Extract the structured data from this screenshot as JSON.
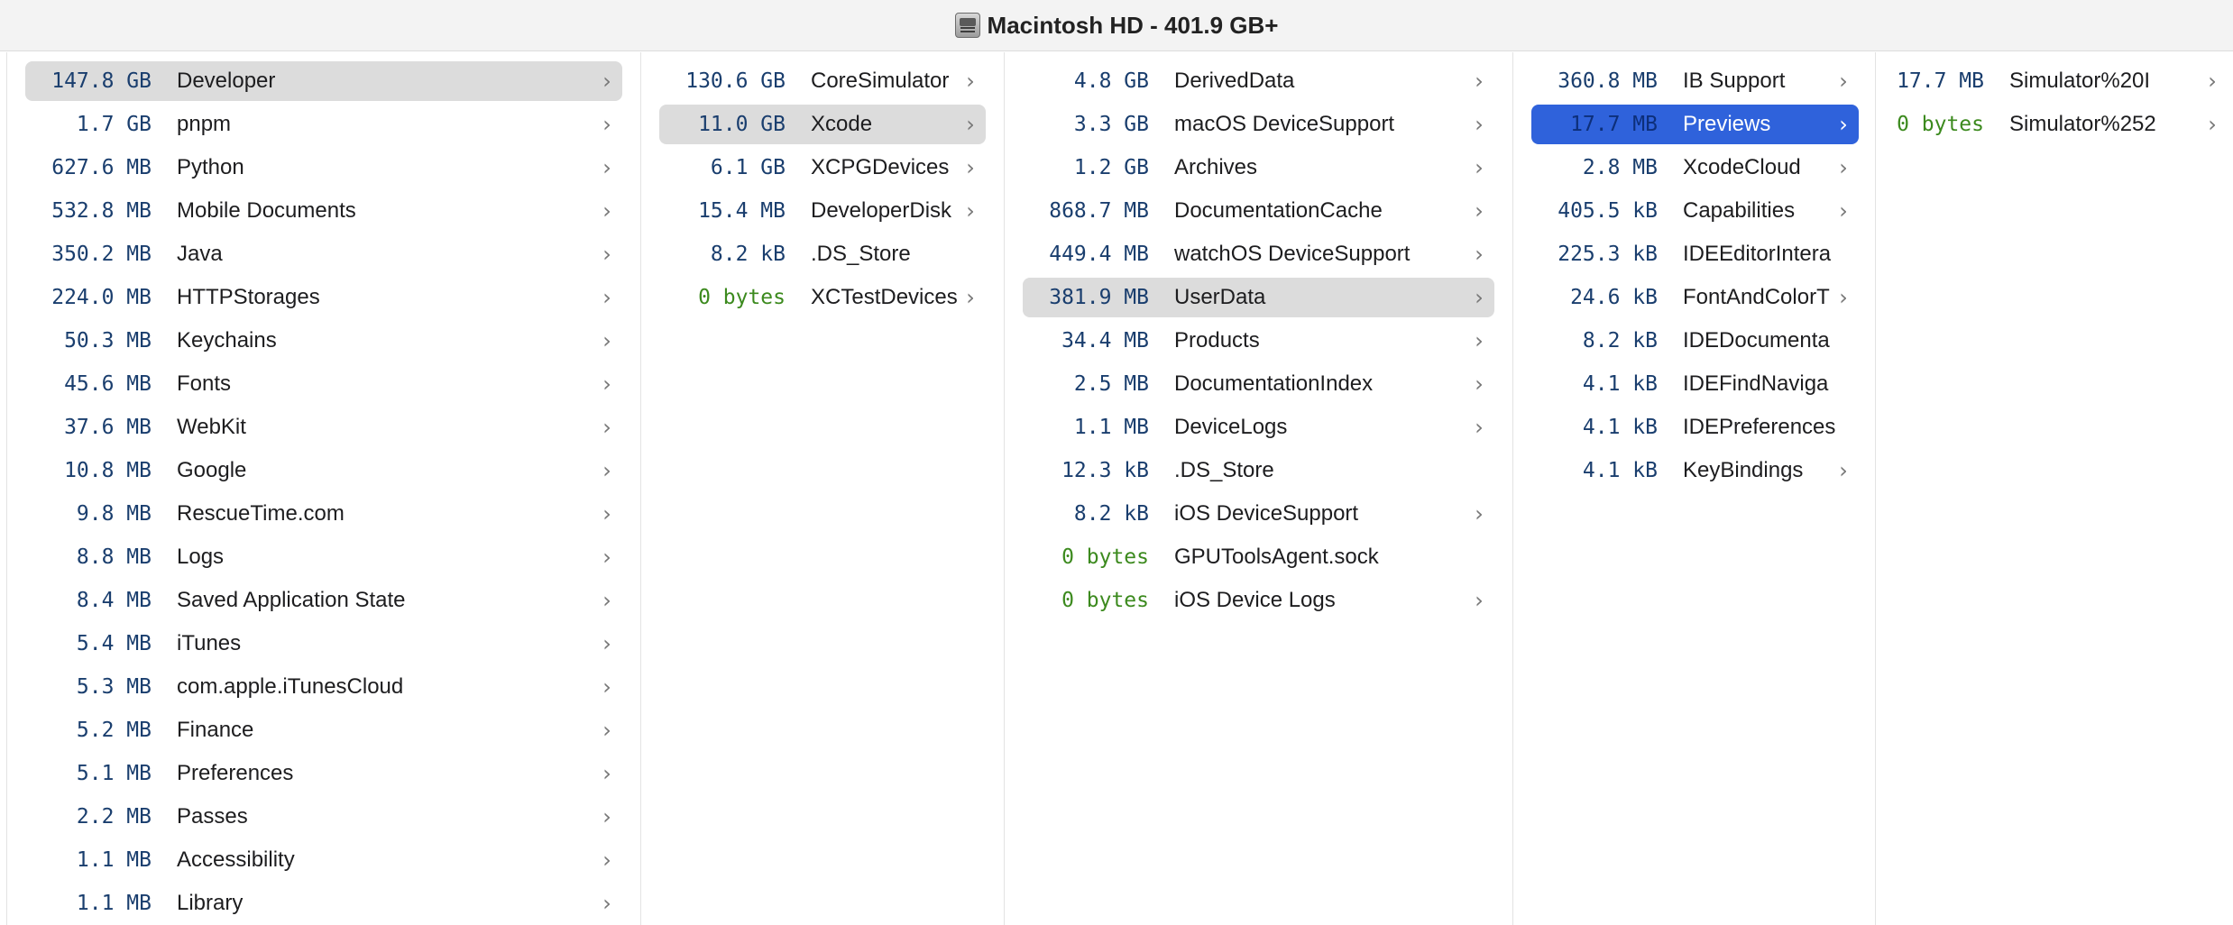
{
  "window": {
    "title": "Macintosh HD - 401.9 GB+",
    "icon": "hard-disk-icon"
  },
  "colors": {
    "selection_gray": "#dcdcdc",
    "selection_blue": "#2f62db",
    "size_text": "#1a3e6e",
    "zero_size_text": "#3c8a1e"
  },
  "columns": [
    {
      "items": [
        {
          "size": "147.8 GB",
          "name": "Developer",
          "chevron": true,
          "selected": "gray"
        },
        {
          "size": "1.7 GB",
          "name": "pnpm",
          "chevron": true
        },
        {
          "size": "627.6 MB",
          "name": "Python",
          "chevron": true
        },
        {
          "size": "532.8 MB",
          "name": "Mobile Documents",
          "chevron": true
        },
        {
          "size": "350.2 MB",
          "name": "Java",
          "chevron": true
        },
        {
          "size": "224.0 MB",
          "name": "HTTPStorages",
          "chevron": true
        },
        {
          "size": "50.3 MB",
          "name": "Keychains",
          "chevron": true
        },
        {
          "size": "45.6 MB",
          "name": "Fonts",
          "chevron": true
        },
        {
          "size": "37.6 MB",
          "name": "WebKit",
          "chevron": true
        },
        {
          "size": "10.8 MB",
          "name": "Google",
          "chevron": true
        },
        {
          "size": "9.8 MB",
          "name": "RescueTime.com",
          "chevron": true
        },
        {
          "size": "8.8 MB",
          "name": "Logs",
          "chevron": true
        },
        {
          "size": "8.4 MB",
          "name": "Saved Application State",
          "chevron": true
        },
        {
          "size": "5.4 MB",
          "name": "iTunes",
          "chevron": true
        },
        {
          "size": "5.3 MB",
          "name": "com.apple.iTunesCloud",
          "chevron": true
        },
        {
          "size": "5.2 MB",
          "name": "Finance",
          "chevron": true
        },
        {
          "size": "5.1 MB",
          "name": "Preferences",
          "chevron": true
        },
        {
          "size": "2.2 MB",
          "name": "Passes",
          "chevron": true
        },
        {
          "size": "1.1 MB",
          "name": "Accessibility",
          "chevron": true
        },
        {
          "size": "1.1 MB",
          "name": "Library",
          "chevron": true
        }
      ]
    },
    {
      "items": [
        {
          "size": "130.6 GB",
          "name": "CoreSimulator",
          "chevron": true
        },
        {
          "size": "11.0 GB",
          "name": "Xcode",
          "chevron": true,
          "selected": "gray"
        },
        {
          "size": "6.1 GB",
          "name": "XCPGDevices",
          "chevron": true
        },
        {
          "size": "15.4 MB",
          "name": "DeveloperDisk",
          "chevron": true
        },
        {
          "size": "8.2 kB",
          "name": ".DS_Store",
          "chevron": false
        },
        {
          "size": "0 bytes",
          "name": "XCTestDevices",
          "chevron": true,
          "zero": true
        }
      ]
    },
    {
      "items": [
        {
          "size": "4.8 GB",
          "name": "DerivedData",
          "chevron": true
        },
        {
          "size": "3.3 GB",
          "name": "macOS DeviceSupport",
          "chevron": true
        },
        {
          "size": "1.2 GB",
          "name": "Archives",
          "chevron": true
        },
        {
          "size": "868.7 MB",
          "name": "DocumentationCache",
          "chevron": true
        },
        {
          "size": "449.4 MB",
          "name": "watchOS DeviceSupport",
          "chevron": true
        },
        {
          "size": "381.9 MB",
          "name": "UserData",
          "chevron": true,
          "selected": "gray"
        },
        {
          "size": "34.4 MB",
          "name": "Products",
          "chevron": true
        },
        {
          "size": "2.5 MB",
          "name": "DocumentationIndex",
          "chevron": true
        },
        {
          "size": "1.1 MB",
          "name": "DeviceLogs",
          "chevron": true
        },
        {
          "size": "12.3 kB",
          "name": ".DS_Store",
          "chevron": false
        },
        {
          "size": "8.2 kB",
          "name": "iOS DeviceSupport",
          "chevron": true
        },
        {
          "size": "0 bytes",
          "name": "GPUToolsAgent.sock",
          "chevron": false,
          "zero": true
        },
        {
          "size": "0 bytes",
          "name": "iOS Device Logs",
          "chevron": true,
          "zero": true
        }
      ]
    },
    {
      "items": [
        {
          "size": "360.8 MB",
          "name": "IB Support",
          "chevron": true
        },
        {
          "size": "17.7 MB",
          "name": "Previews",
          "chevron": true,
          "selected": "blue"
        },
        {
          "size": "2.8 MB",
          "name": "XcodeCloud",
          "chevron": true
        },
        {
          "size": "405.5 kB",
          "name": "Capabilities",
          "chevron": true
        },
        {
          "size": "225.3 kB",
          "name": "IDEEditorIntera",
          "chevron": false
        },
        {
          "size": "24.6 kB",
          "name": "FontAndColorT",
          "chevron": true
        },
        {
          "size": "8.2 kB",
          "name": "IDEDocumenta",
          "chevron": false
        },
        {
          "size": "4.1 kB",
          "name": "IDEFindNaviga",
          "chevron": false
        },
        {
          "size": "4.1 kB",
          "name": "IDEPreferences",
          "chevron": false
        },
        {
          "size": "4.1 kB",
          "name": "KeyBindings",
          "chevron": true
        }
      ]
    },
    {
      "items": [
        {
          "size": "17.7 MB",
          "name": "Simulator%20I",
          "chevron": true
        },
        {
          "size": "0 bytes",
          "name": "Simulator%252",
          "chevron": true,
          "zero": true
        }
      ]
    }
  ]
}
